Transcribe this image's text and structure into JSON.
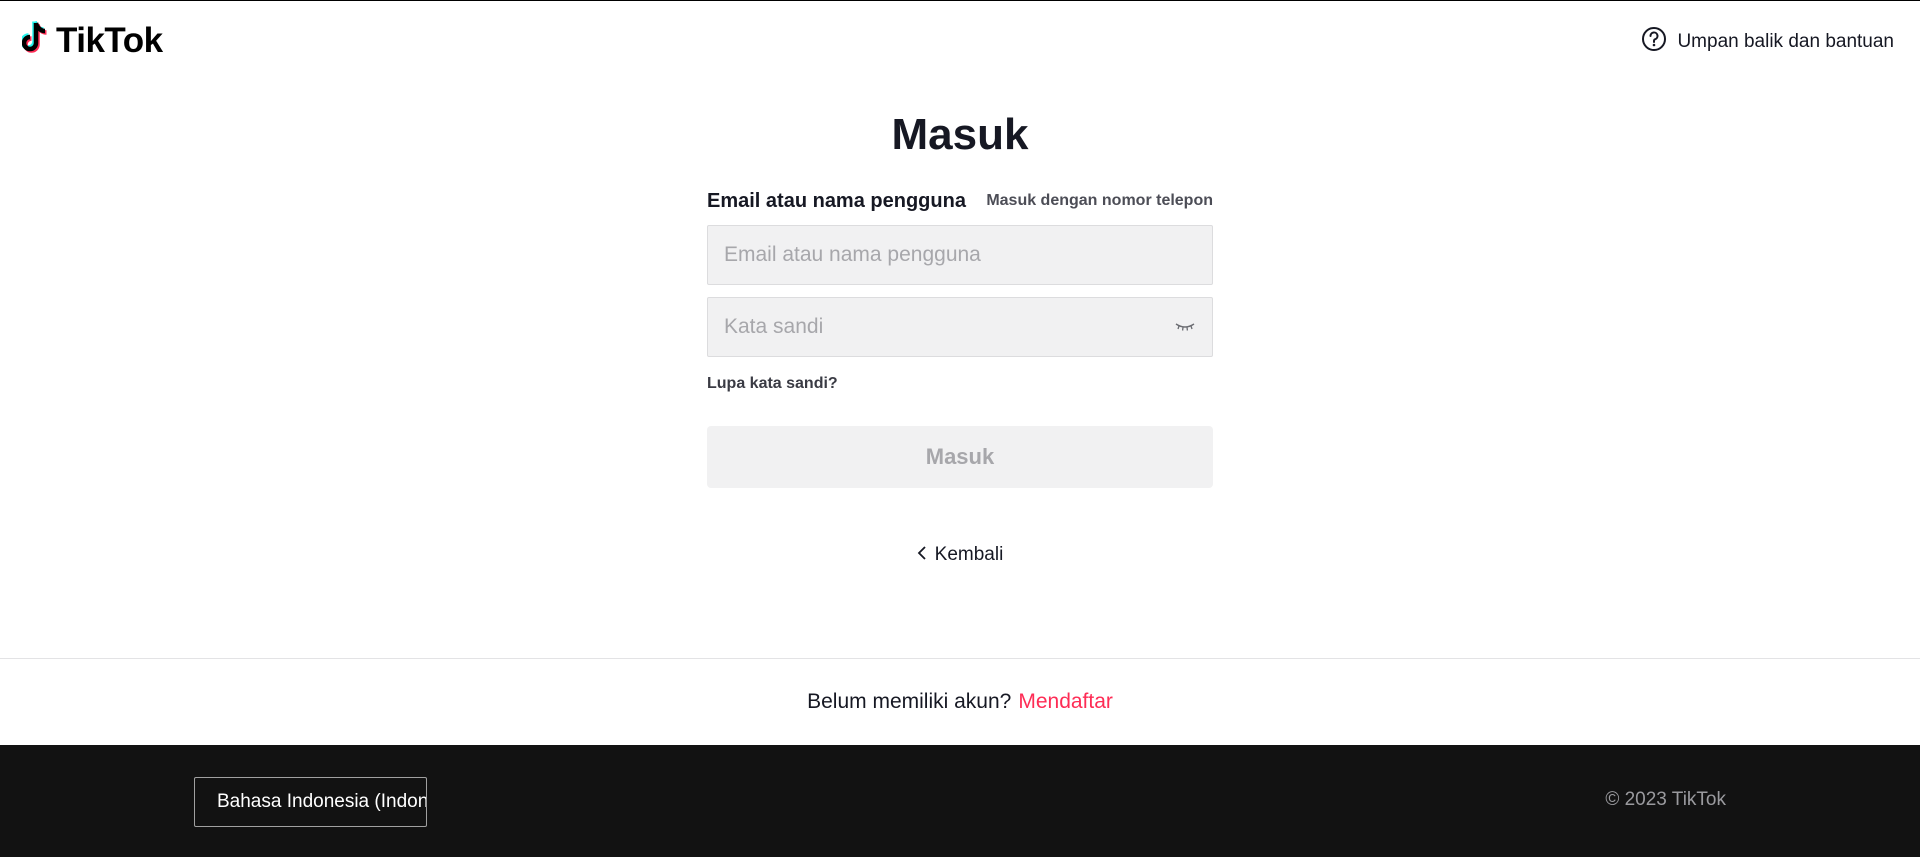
{
  "header": {
    "logo_text": "TikTok",
    "help_label": "Umpan balik dan bantuan"
  },
  "login": {
    "title": "Masuk",
    "field_label": "Email atau nama pengguna",
    "phone_link": "Masuk dengan nomor telepon",
    "email_placeholder": "Email atau nama pengguna",
    "email_value": "",
    "password_placeholder": "Kata sandi",
    "password_value": "",
    "forgot_link": "Lupa kata sandi?",
    "submit_label": "Masuk",
    "back_label": "Kembali"
  },
  "signup": {
    "question": "Belum memiliki akun?",
    "link": "Mendaftar"
  },
  "footer": {
    "language": "Bahasa Indonesia (Indonesia)",
    "copyright": "© 2023 TikTok"
  },
  "colors": {
    "accent": "#fe2c55",
    "cyan": "#25f4ee",
    "footer_bg": "#121212"
  },
  "icons": {
    "logo": "tiktok-note-icon",
    "help": "question-circle-icon",
    "password_toggle": "eye-closed-icon",
    "back": "chevron-left-icon"
  }
}
